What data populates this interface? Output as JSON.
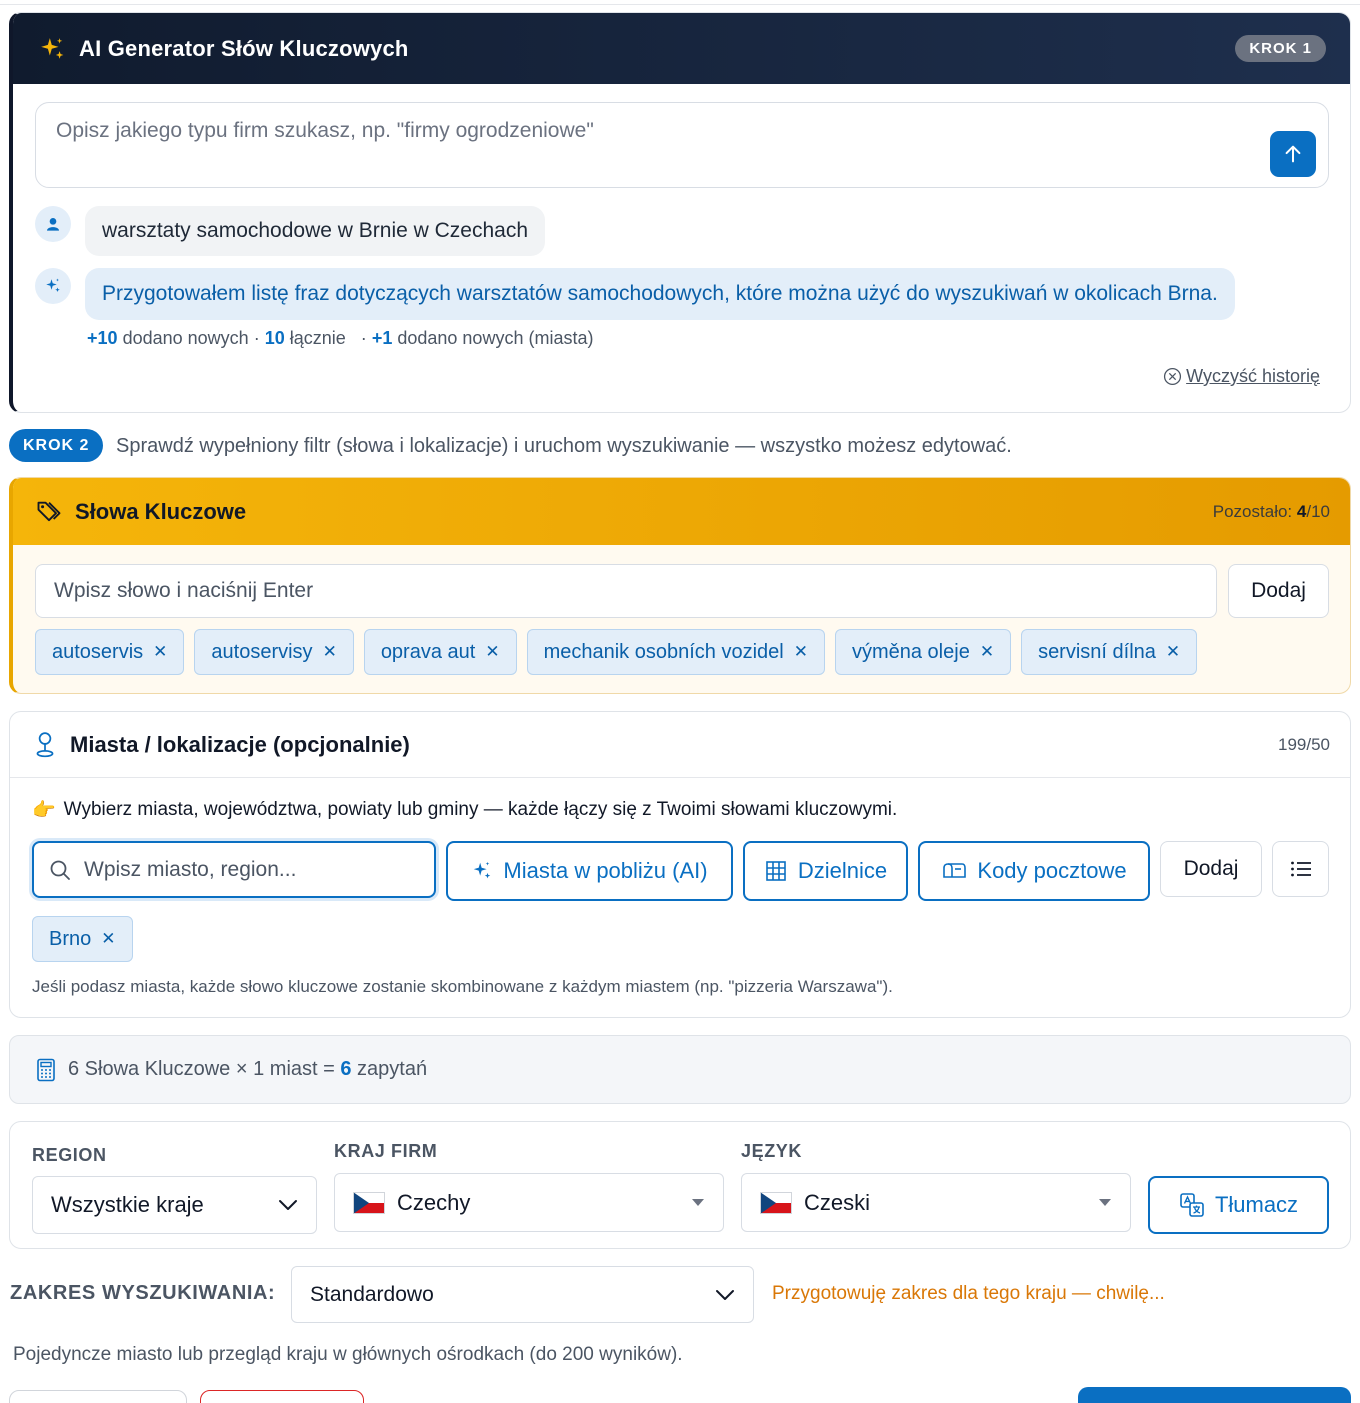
{
  "step1": {
    "title": "AI Generator Słów Kluczowych",
    "badge": "KROK 1",
    "prompt_placeholder": "Opisz jakiego typu firm szukasz, np. \"firmy ogrodzeniowe\"",
    "user_message": "warsztaty samochodowe w Brnie w Czechach",
    "ai_message": "Przygotowałem listę fraz dotyczących warsztatów samochodowych, które można użyć do wyszukiwań w okolicach Brna.",
    "stats": {
      "added_count": "+10",
      "added_label": "dodano nowych",
      "sep1": "·",
      "total_count": "10",
      "total_label": "łącznie",
      "sep2": "·",
      "cities_count": "+1",
      "cities_label": "dodano nowych (miasta)"
    },
    "clear_history": "Wyczyść historię"
  },
  "step2": {
    "badge": "KROK 2",
    "text": "Sprawdź wypełniony filtr (słowa i lokalizacje) i uruchom wyszukiwanie — wszystko możesz edytować."
  },
  "keywords": {
    "title": "Słowa Kluczowe",
    "remaining_label": "Pozostało:",
    "remaining_value": "4",
    "remaining_max": "/10",
    "input_placeholder": "Wpisz słowo i naciśnij Enter",
    "add_label": "Dodaj",
    "items": [
      "autoservis",
      "autoservisy",
      "oprava aut",
      "mechanik osobních vozidel",
      "výměna oleje",
      "servisní dílna"
    ]
  },
  "cities": {
    "title": "Miasta / lokalizacje (opcjonalnie)",
    "count": "199/50",
    "hint_emoji": "👉",
    "hint": "Wybierz miasta, województwa, powiaty lub gminy — każde łączy się z Twoimi słowami kluczowymi.",
    "search_placeholder": "Wpisz miasto, region...",
    "btn_ai": "Miasta w pobliżu (AI)",
    "btn_districts": "Dzielnice",
    "btn_postal": "Kody pocztowe",
    "add_label": "Dodaj",
    "items": [
      "Brno"
    ],
    "note": "Jeśli podasz miasta, każde słowo kluczowe zostanie skombinowane z każdym miastem (np. \"pizzeria Warszawa\")."
  },
  "summary": {
    "left": "6 Słowa Kluczowe × 1 miast =",
    "value": "6",
    "right": "zapytań"
  },
  "region": {
    "region_label": "REGION",
    "region_value": "Wszystkie kraje",
    "country_label": "KRAJ FIRM",
    "country_value": "Czechy",
    "language_label": "JĘZYK",
    "language_value": "Czeski",
    "translate_label": "Tłumacz"
  },
  "scope": {
    "label": "ZAKRES WYSZUKIWANIA:",
    "value": "Standardowo",
    "status": "Przygotowuję zakres dla tego kraju — chwilę...",
    "description": "Pojedyncze miasto lub przegląd kraju w głównych ośrodkach (do 200 wyników)."
  },
  "colors": {
    "primary": "#0a6fc2",
    "header_dark": "#101b2e",
    "keywords_header": "#f5b50a",
    "chip_bg": "#e3eef9",
    "status_orange": "#d97706"
  }
}
